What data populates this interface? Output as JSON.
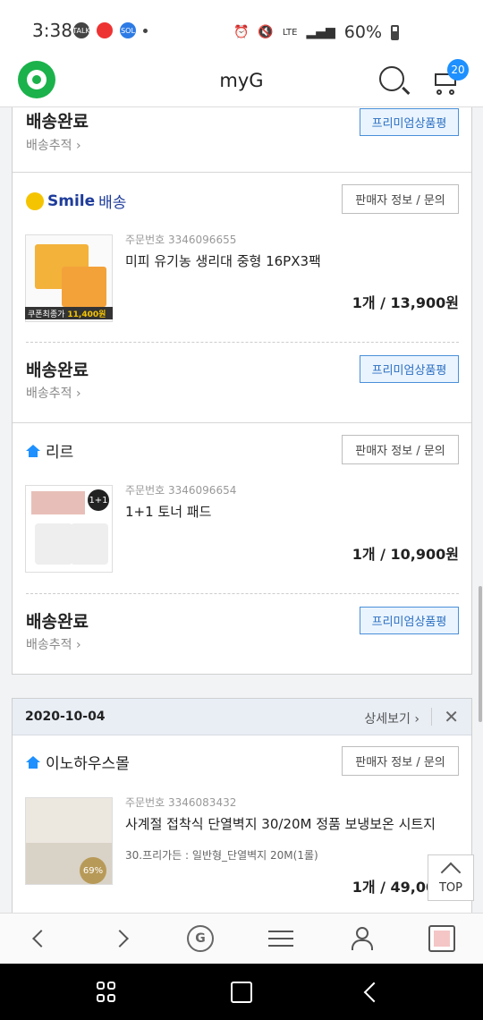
{
  "status_bar": {
    "time": "3:38",
    "battery": "60%",
    "notif_icons": [
      "talk-icon",
      "megaphone-icon",
      "sol-icon"
    ],
    "right_icons": [
      "alarm-icon",
      "mute-icon",
      "lte-icon",
      "signal-icon"
    ]
  },
  "app_bar": {
    "title": "myG",
    "cart_count": "20"
  },
  "orders": [
    {
      "status": "배송완료",
      "track": "배송추적",
      "review_label": "프리미엄상품평"
    },
    {
      "seller": "배송",
      "seller_brand": "Smile",
      "seller_button": "판매자 정보 / 문의",
      "order_label": "주문번호",
      "order_no": "3346096655",
      "product": "미피 유기농 생리대 중형 16PX3팩",
      "qty_price": "1개 / 13,900원",
      "coupon": "쿠폰최종가",
      "coupon_price": "11,400원",
      "status": "배송완료",
      "track": "배송추적",
      "review_label": "프리미엄상품평"
    },
    {
      "seller": "리르",
      "seller_button": "판매자 정보 / 문의",
      "order_label": "주문번호",
      "order_no": "3346096654",
      "product": "1+1 토너 패드",
      "badge": "1+1",
      "qty_price": "1개 / 10,900원",
      "status": "배송완료",
      "track": "배송추적",
      "review_label": "프리미엄상품평"
    }
  ],
  "date_group": {
    "date": "2020-10-04",
    "detail_link": "상세보기",
    "close": "✕",
    "seller": "이노하우스몰",
    "seller_button": "판매자 정보 / 문의",
    "order_label": "주문번호",
    "order_no": "3346083432",
    "product": "사계절 접착식 단열벽지 30/20M 정품 보냉보온 시트지",
    "option": "30.프리가든 : 일반형_단열벽지 20M(1롤)",
    "qty_price": "1개 / 49,000원",
    "thumb_badge": "69%"
  },
  "top_button": "TOP",
  "bottom_nav": [
    "back-icon",
    "forward-icon",
    "g-home-icon",
    "menu-icon",
    "person-icon",
    "recent-view-icon"
  ],
  "colors": {
    "brand_green": "#1bb24b",
    "accent_blue": "#1e90ff",
    "review_blue": "#2b6fc0"
  }
}
